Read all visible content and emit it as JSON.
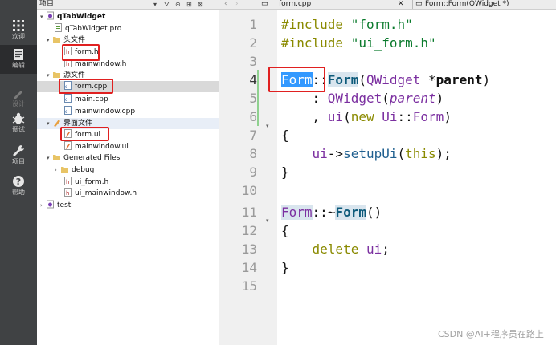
{
  "modebar": {
    "items": [
      {
        "label": "欢迎",
        "icon": "grid-icon"
      },
      {
        "label": "编辑",
        "icon": "edit-icon"
      },
      {
        "label": "设计",
        "icon": "pencil-icon"
      },
      {
        "label": "调试",
        "icon": "bug-icon"
      },
      {
        "label": "项目",
        "icon": "wrench-icon"
      },
      {
        "label": "帮助",
        "icon": "help-icon"
      }
    ]
  },
  "tree": {
    "header": "项目",
    "nodes": [
      {
        "label": "qTabWidget"
      },
      {
        "label": "qTabWidget.pro"
      },
      {
        "label": "头文件"
      },
      {
        "label": "form.h"
      },
      {
        "label": "mainwindow.h"
      },
      {
        "label": "源文件"
      },
      {
        "label": "form.cpp"
      },
      {
        "label": "main.cpp"
      },
      {
        "label": "mainwindow.cpp"
      },
      {
        "label": "界面文件"
      },
      {
        "label": "form.ui"
      },
      {
        "label": "mainwindow.ui"
      },
      {
        "label": "Generated Files"
      },
      {
        "label": "debug"
      },
      {
        "label": "ui_form.h"
      },
      {
        "label": "ui_mainwindow.h"
      },
      {
        "label": "test"
      }
    ]
  },
  "editor": {
    "file_tab": "form.cpp",
    "symbol": "Form::Form(QWidget *)",
    "line_numbers": [
      "1",
      "2",
      "3",
      "4",
      "5",
      "6",
      "7",
      "8",
      "9",
      "10",
      "11",
      "12",
      "13",
      "14",
      "15"
    ],
    "code": {
      "l1a": "#include ",
      "l1b": "\"form.h\"",
      "l2a": "#include ",
      "l2b": "\"ui_form.h\"",
      "l4a": "Form",
      "l4b": "::",
      "l4c": "Form",
      "l4d": "(",
      "l4e": "QWidget",
      "l4f": " *",
      "l4g": "parent",
      "l4h": ")",
      "l5a": "    : ",
      "l5b": "QWidget",
      "l5c": "(",
      "l5d": "parent",
      "l5e": ")",
      "l6a": "    , ",
      "l6b": "ui",
      "l6c": "(",
      "l6d": "new",
      "l6e": " ",
      "l6f": "Ui",
      "l6g": "::",
      "l6h": "Form",
      "l6i": ")",
      "l7": "{",
      "l8a": "    ",
      "l8b": "ui",
      "l8c": "->",
      "l8d": "setupUi",
      "l8e": "(",
      "l8f": "this",
      "l8g": ");",
      "l9": "}",
      "l11a": "Form",
      "l11b": "::~",
      "l11c": "Form",
      "l11d": "()",
      "l12": "{",
      "l13a": "    ",
      "l13b": "delete",
      "l13c": " ",
      "l13d": "ui",
      "l13e": ";",
      "l14": "}"
    }
  },
  "watermark": "CSDN @AI+程序员在路上"
}
